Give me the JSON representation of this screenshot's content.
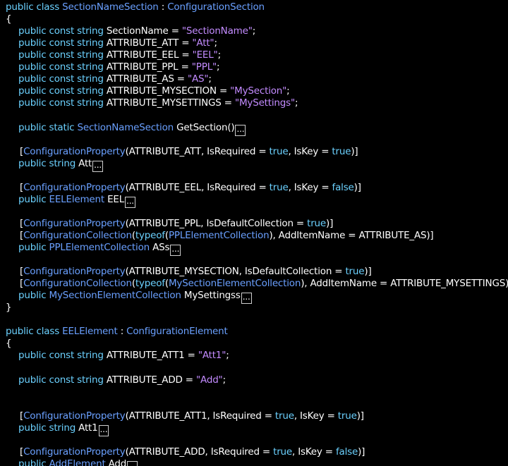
{
  "editor": {
    "lines": [
      {
        "row": 0,
        "indent": 0,
        "tokens": [
          [
            "k",
            "public class "
          ],
          [
            "t",
            "SectionNameSection"
          ],
          [
            "p",
            " : "
          ],
          [
            "t",
            "ConfigurationSection"
          ]
        ]
      },
      {
        "row": 1,
        "indent": 0,
        "tokens": [
          [
            "p",
            "{"
          ]
        ]
      },
      {
        "row": 2,
        "indent": 1,
        "tokens": [
          [
            "k",
            "public const string "
          ],
          [
            "p",
            "SectionName = "
          ],
          [
            "s",
            "\"SectionName\""
          ],
          [
            "p",
            ";"
          ]
        ]
      },
      {
        "row": 3,
        "indent": 1,
        "tokens": [
          [
            "k",
            "public const string "
          ],
          [
            "p",
            "ATTRIBUTE_ATT = "
          ],
          [
            "s",
            "\"Att\""
          ],
          [
            "p",
            ";"
          ]
        ]
      },
      {
        "row": 4,
        "indent": 1,
        "tokens": [
          [
            "k",
            "public const string "
          ],
          [
            "p",
            "ATTRIBUTE_EEL = "
          ],
          [
            "s",
            "\"EEL\""
          ],
          [
            "p",
            ";"
          ]
        ]
      },
      {
        "row": 5,
        "indent": 1,
        "tokens": [
          [
            "k",
            "public const string "
          ],
          [
            "p",
            "ATTRIBUTE_PPL = "
          ],
          [
            "s",
            "\"PPL\""
          ],
          [
            "p",
            ";"
          ]
        ]
      },
      {
        "row": 6,
        "indent": 1,
        "tokens": [
          [
            "k",
            "public const string "
          ],
          [
            "p",
            "ATTRIBUTE_AS = "
          ],
          [
            "s",
            "\"AS\""
          ],
          [
            "p",
            ";"
          ]
        ]
      },
      {
        "row": 7,
        "indent": 1,
        "tokens": [
          [
            "k",
            "public const string "
          ],
          [
            "p",
            "ATTRIBUTE_MYSECTION = "
          ],
          [
            "s",
            "\"MySection\""
          ],
          [
            "p",
            ";"
          ]
        ]
      },
      {
        "row": 8,
        "indent": 1,
        "tokens": [
          [
            "k",
            "public const string "
          ],
          [
            "p",
            "ATTRIBUTE_MYSETTINGS = "
          ],
          [
            "s",
            "\"MySettings\""
          ],
          [
            "p",
            ";"
          ]
        ]
      },
      {
        "row": 10,
        "indent": 1,
        "tokens": [
          [
            "k",
            "public static "
          ],
          [
            "t",
            "SectionNameSection"
          ],
          [
            "p",
            " GetSection()"
          ]
        ],
        "fold": "..."
      },
      {
        "row": 12,
        "indent": 2,
        "tokens": [
          [
            "p",
            "["
          ],
          [
            "t",
            "ConfigurationProperty"
          ],
          [
            "p",
            "(ATTRIBUTE_ATT, IsRequired = "
          ],
          [
            "k",
            "true"
          ],
          [
            "p",
            ", IsKey = "
          ],
          [
            "k",
            "true"
          ],
          [
            "p",
            ")]"
          ]
        ]
      },
      {
        "row": 13,
        "indent": 1,
        "tokens": [
          [
            "k",
            "public string "
          ],
          [
            "p",
            "Att"
          ]
        ],
        "fold": "..."
      },
      {
        "row": 15,
        "indent": 2,
        "tokens": [
          [
            "p",
            "["
          ],
          [
            "t",
            "ConfigurationProperty"
          ],
          [
            "p",
            "(ATTRIBUTE_EEL, IsRequired = "
          ],
          [
            "k",
            "true"
          ],
          [
            "p",
            ", IsKey = "
          ],
          [
            "k",
            "false"
          ],
          [
            "p",
            ")]"
          ]
        ]
      },
      {
        "row": 16,
        "indent": 1,
        "tokens": [
          [
            "k",
            "public "
          ],
          [
            "t",
            "EELElement"
          ],
          [
            "p",
            " EEL"
          ]
        ],
        "fold": "..."
      },
      {
        "row": 18,
        "indent": 2,
        "tokens": [
          [
            "p",
            "["
          ],
          [
            "t",
            "ConfigurationProperty"
          ],
          [
            "p",
            "(ATTRIBUTE_PPL, IsDefaultCollection = "
          ],
          [
            "k",
            "true"
          ],
          [
            "p",
            ")]"
          ]
        ]
      },
      {
        "row": 19,
        "indent": 2,
        "tokens": [
          [
            "p",
            "["
          ],
          [
            "t",
            "ConfigurationCollection"
          ],
          [
            "p",
            "("
          ],
          [
            "k",
            "typeof"
          ],
          [
            "p",
            "("
          ],
          [
            "t",
            "PPLElementCollection"
          ],
          [
            "p",
            "), AddItemName = ATTRIBUTE_AS)]"
          ]
        ]
      },
      {
        "row": 20,
        "indent": 1,
        "tokens": [
          [
            "k",
            "public "
          ],
          [
            "t",
            "PPLElementCollection"
          ],
          [
            "p",
            " ASs"
          ]
        ],
        "fold": "..."
      },
      {
        "row": 22,
        "indent": 2,
        "tokens": [
          [
            "p",
            "["
          ],
          [
            "t",
            "ConfigurationProperty"
          ],
          [
            "p",
            "(ATTRIBUTE_MYSECTION, IsDefaultCollection = "
          ],
          [
            "k",
            "true"
          ],
          [
            "p",
            ")]"
          ]
        ]
      },
      {
        "row": 23,
        "indent": 2,
        "tokens": [
          [
            "p",
            "["
          ],
          [
            "t",
            "ConfigurationCollection"
          ],
          [
            "p",
            "("
          ],
          [
            "k",
            "typeof"
          ],
          [
            "p",
            "("
          ],
          [
            "t",
            "MySectionElementCollection"
          ],
          [
            "p",
            "), AddItemName = ATTRIBUTE_MYSETTINGS)]"
          ]
        ]
      },
      {
        "row": 24,
        "indent": 1,
        "tokens": [
          [
            "k",
            "public "
          ],
          [
            "t",
            "MySectionElementCollection"
          ],
          [
            "p",
            " MySettingss"
          ]
        ],
        "fold": "..."
      },
      {
        "row": 25,
        "indent": 0,
        "tokens": [
          [
            "p",
            "}"
          ]
        ]
      },
      {
        "row": 27,
        "indent": 0,
        "tokens": [
          [
            "k",
            "public class "
          ],
          [
            "t",
            "EELElement"
          ],
          [
            "p",
            " : "
          ],
          [
            "t",
            "ConfigurationElement"
          ]
        ]
      },
      {
        "row": 28,
        "indent": 0,
        "tokens": [
          [
            "p",
            "{"
          ]
        ]
      },
      {
        "row": 29,
        "indent": 1,
        "tokens": [
          [
            "k",
            "public const string "
          ],
          [
            "p",
            "ATTRIBUTE_ATT1 = "
          ],
          [
            "s",
            "\"Att1\""
          ],
          [
            "p",
            ";"
          ]
        ]
      },
      {
        "row": 31,
        "indent": 1,
        "tokens": [
          [
            "k",
            "public const string "
          ],
          [
            "p",
            "ATTRIBUTE_ADD = "
          ],
          [
            "s",
            "\"Add\""
          ],
          [
            "p",
            ";"
          ]
        ]
      },
      {
        "row": 34,
        "indent": 2,
        "tokens": [
          [
            "p",
            "["
          ],
          [
            "t",
            "ConfigurationProperty"
          ],
          [
            "p",
            "(ATTRIBUTE_ATT1, IsRequired = "
          ],
          [
            "k",
            "true"
          ],
          [
            "p",
            ", IsKey = "
          ],
          [
            "k",
            "true"
          ],
          [
            "p",
            ")]"
          ]
        ]
      },
      {
        "row": 35,
        "indent": 1,
        "tokens": [
          [
            "k",
            "public string "
          ],
          [
            "p",
            "Att1"
          ]
        ],
        "fold": "..."
      },
      {
        "row": 37,
        "indent": 2,
        "tokens": [
          [
            "p",
            "["
          ],
          [
            "t",
            "ConfigurationProperty"
          ],
          [
            "p",
            "(ATTRIBUTE_ADD, IsRequired = "
          ],
          [
            "k",
            "true"
          ],
          [
            "p",
            ", IsKey = "
          ],
          [
            "k",
            "false"
          ],
          [
            "p",
            ")]"
          ]
        ]
      },
      {
        "row": 38,
        "indent": 1,
        "tokens": [
          [
            "k",
            "public "
          ],
          [
            "t",
            "AddElement"
          ],
          [
            "p",
            " Add"
          ]
        ],
        "fold": "..."
      }
    ]
  }
}
